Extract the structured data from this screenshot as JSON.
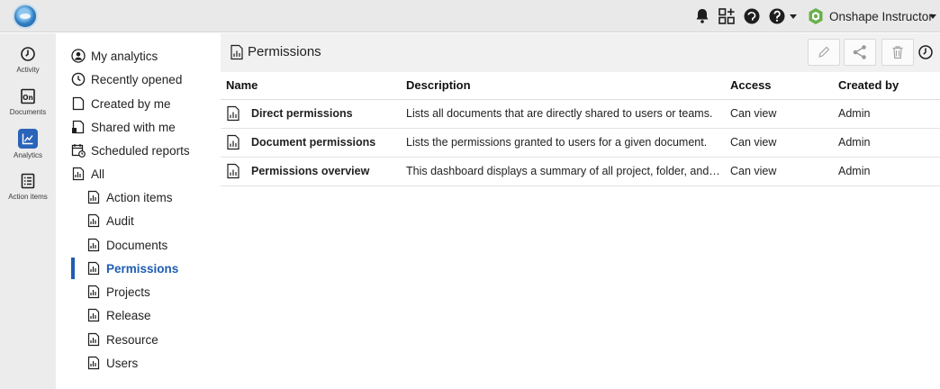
{
  "header": {
    "user_name": "Onshape Instructor",
    "icons": [
      "bell-icon",
      "app-store-icon",
      "learning-center-icon",
      "help-icon"
    ]
  },
  "rail": {
    "items": [
      {
        "label": "Activity",
        "icon": "activity-icon"
      },
      {
        "label": "Documents",
        "icon": "documents-icon"
      },
      {
        "label": "Analytics",
        "icon": "analytics-icon",
        "active": true
      },
      {
        "label": "Action items",
        "icon": "action-items-icon"
      }
    ]
  },
  "nav": {
    "items": [
      {
        "label": "My analytics",
        "icon": "user-icon"
      },
      {
        "label": "Recently opened",
        "icon": "clock-icon"
      },
      {
        "label": "Created by me",
        "icon": "document-icon"
      },
      {
        "label": "Shared with me",
        "icon": "shared-icon"
      },
      {
        "label": "Scheduled reports",
        "icon": "calendar-icon"
      },
      {
        "label": "All",
        "icon": "report-icon"
      },
      {
        "label": "Action items",
        "icon": "report-icon"
      },
      {
        "label": "Audit",
        "icon": "report-icon"
      },
      {
        "label": "Documents",
        "icon": "report-icon"
      },
      {
        "label": "Permissions",
        "icon": "report-icon",
        "active": true
      },
      {
        "label": "Projects",
        "icon": "report-icon"
      },
      {
        "label": "Release",
        "icon": "report-icon"
      },
      {
        "label": "Resource",
        "icon": "report-icon"
      },
      {
        "label": "Users",
        "icon": "report-icon"
      }
    ]
  },
  "main": {
    "title": "Permissions",
    "columns": [
      "Name",
      "Description",
      "Access",
      "Created by"
    ],
    "rows": [
      {
        "name": "Direct permissions",
        "description": "Lists all documents that are directly shared to users or teams.",
        "access": "Can view",
        "created_by": "Admin"
      },
      {
        "name": "Document permissions",
        "description": "Lists the permissions granted to users for a given document.",
        "access": "Can view",
        "created_by": "Admin"
      },
      {
        "name": "Permissions overview",
        "description": "This dashboard displays a summary of all project, folder, and d...",
        "access": "Can view",
        "created_by": "Admin"
      }
    ]
  },
  "colors": {
    "accent": "#1f5db3",
    "topbar": "#e9e9e9",
    "rail": "#ececec"
  }
}
